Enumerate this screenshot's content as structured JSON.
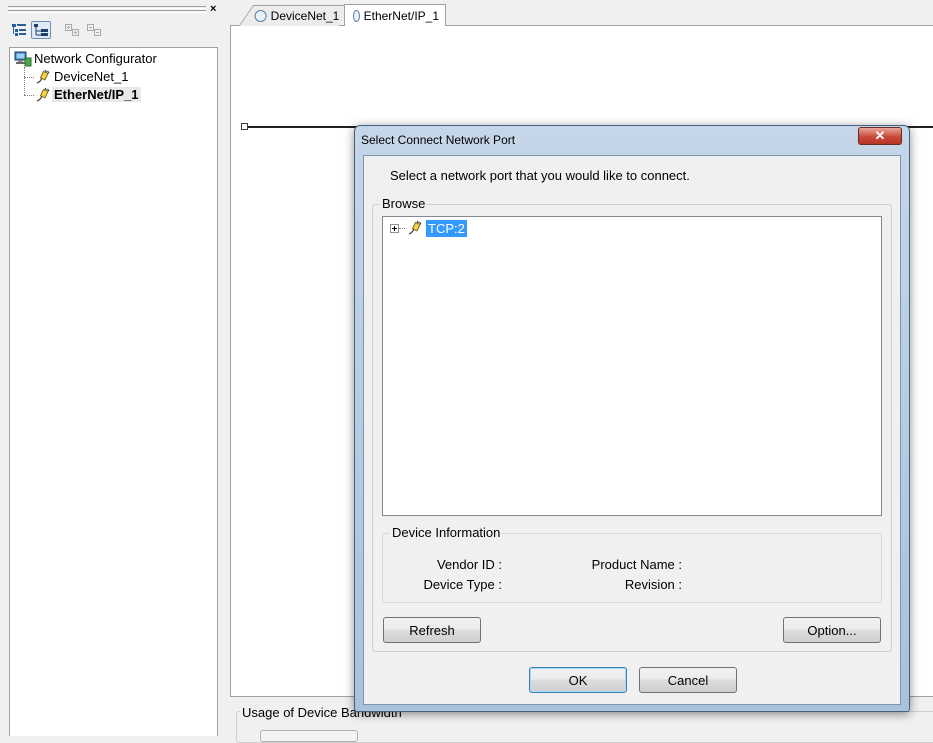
{
  "left_pane": {
    "close_glyph": "×",
    "toolbar": [
      {
        "name": "tree-view-icon",
        "active": false
      },
      {
        "name": "network-view-icon",
        "active": true
      },
      {
        "name": "expand-all-icon",
        "active": false
      },
      {
        "name": "collapse-all-icon",
        "active": false
      }
    ],
    "tree": {
      "root": "Network Configurator",
      "children": [
        "DeviceNet_1",
        "EtherNet/IP_1"
      ],
      "selected": "EtherNet/IP_1"
    }
  },
  "tabs": [
    {
      "label": "DeviceNet_1",
      "active": false
    },
    {
      "label": "EtherNet/IP_1",
      "active": true
    }
  ],
  "bottom_panel": {
    "group_label": "Usage of Device Bandwidth"
  },
  "dialog": {
    "title": "Select Connect Network Port",
    "close_glyph": "✕",
    "instruction": "Select a network port that you would like to connect.",
    "browse_label": "Browse",
    "browse_items": [
      {
        "label": "TCP:2",
        "selected": true,
        "expandable": true
      }
    ],
    "device_info": {
      "label": "Device Information",
      "vendor_id": "Vendor ID :",
      "device_type": "Device Type :",
      "product_name": "Product Name :",
      "revision": "Revision :"
    },
    "buttons": {
      "refresh": "Refresh",
      "option": "Option...",
      "ok": "OK",
      "cancel": "Cancel"
    }
  },
  "colors": {
    "selection": "#3399ff",
    "dialog_frame": "#b3c9e0",
    "close_button": "#c9493a"
  }
}
